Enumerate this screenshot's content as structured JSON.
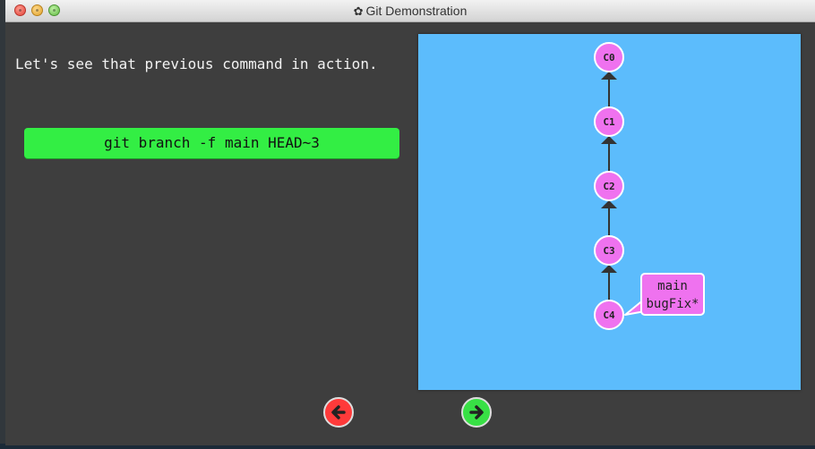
{
  "window": {
    "title": "Git Demonstration",
    "title_icon": "gear-icon"
  },
  "dialog": {
    "text": "Let's see that previous command in action.",
    "command": "git branch -f main HEAD~3"
  },
  "graph": {
    "commits": [
      "C0",
      "C1",
      "C2",
      "C3",
      "C4"
    ],
    "branch_label": {
      "lines": [
        "main",
        "bugFix*"
      ],
      "points_to": "C4"
    },
    "colors": {
      "background": "#5cbcfc",
      "commit_fill": "#ef72ef",
      "commit_stroke": "#ffffff",
      "edge": "#333333"
    }
  },
  "nav": {
    "prev_icon": "arrow-left-icon",
    "next_icon": "arrow-right-icon"
  },
  "colors": {
    "window_bg": "#3e3e3e",
    "command_bg": "#33ee44",
    "prev_bg": "#ff3a3a",
    "next_bg": "#38e045"
  }
}
